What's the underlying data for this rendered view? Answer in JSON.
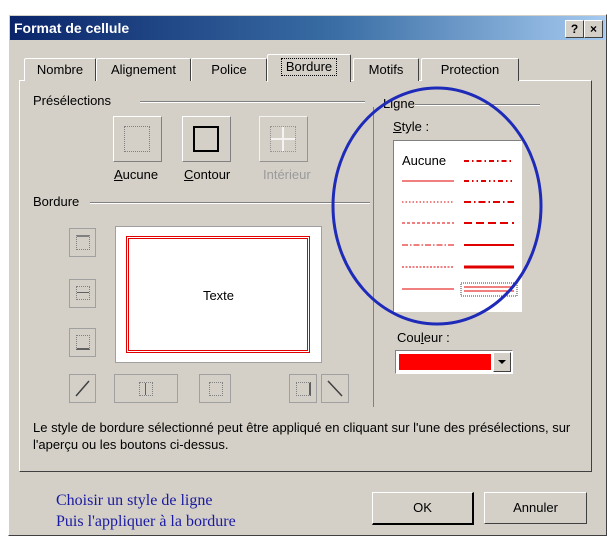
{
  "window": {
    "title": "Format de cellule",
    "help_label": "?",
    "close_label": "×"
  },
  "tabs": [
    {
      "label": "Nombre"
    },
    {
      "label": "Alignement"
    },
    {
      "label": "Police"
    },
    {
      "label": "Bordure",
      "active": true
    },
    {
      "label": "Motifs"
    },
    {
      "label": "Protection"
    }
  ],
  "presets": {
    "heading": "Présélections",
    "items": [
      {
        "label": "Aucune",
        "hotkey": "A",
        "rest": "ucune"
      },
      {
        "label": "Contour",
        "hotkey": "C",
        "rest": "ontour"
      },
      {
        "label": "Intérieur",
        "disabled": true
      }
    ]
  },
  "border": {
    "heading": "Bordure",
    "preview_text": "Texte"
  },
  "line": {
    "heading": "Ligne",
    "style_label": "Style :",
    "style_hotkey": "S",
    "style_rest": "tyle :",
    "none_label": "Aucune",
    "color_label": "Couleur :",
    "color_pre": "Cou",
    "color_hotkey": "l",
    "color_post": "eur :",
    "selected_color": "#ff0000"
  },
  "help_text": "Le style de bordure sélectionné peut être appliqué en cliquant sur l'une des présélections, sur l'aperçu ou les boutons ci-dessus.",
  "annotation": {
    "line1": "Choisir un style de ligne",
    "line2": "Puis l'appliquer à la bordure"
  },
  "buttons": {
    "ok": "OK",
    "cancel": "Annuler"
  },
  "colors": {
    "accent_line": "#e00000",
    "highlight_circle": "#1e2ab8",
    "title_bar": "#0a246a"
  }
}
